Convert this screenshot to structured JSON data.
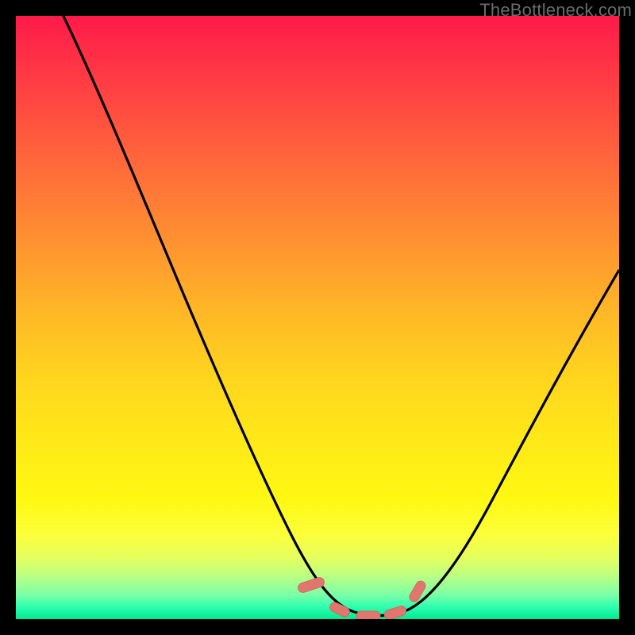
{
  "watermark": "TheBottleneck.com",
  "colors": {
    "background": "#000000",
    "curve_stroke": "#000000",
    "marker_fill": "#e0776e",
    "marker_stroke": "#d8665e",
    "watermark_text": "#6b6b6b"
  },
  "chart_data": {
    "type": "line",
    "title": "",
    "xlabel": "",
    "ylabel": "",
    "xlim": [
      0,
      100
    ],
    "ylim": [
      0,
      100
    ],
    "grid": false,
    "legend": false,
    "background": "rainbow-vertical-gradient",
    "x": [
      0,
      3,
      6,
      9,
      12,
      15,
      18,
      21,
      24,
      27,
      30,
      33,
      36,
      39,
      42,
      45,
      48,
      51,
      54,
      57,
      60,
      63,
      66,
      69,
      72,
      75,
      78,
      81,
      84,
      87,
      90,
      93,
      96,
      100
    ],
    "series": [
      {
        "name": "curve",
        "values": [
          104,
          96,
          89,
          82,
          75,
          69,
          62,
          56,
          50,
          44,
          38,
          33,
          27,
          22,
          17,
          12,
          8,
          5,
          2,
          1,
          0,
          0,
          1,
          4,
          9,
          16,
          24,
          31,
          38,
          44,
          49,
          54,
          59,
          65
        ]
      }
    ],
    "markers": [
      {
        "x": 50,
        "y": 4,
        "shape": "capsule",
        "angle": 75
      },
      {
        "x": 53,
        "y": 1,
        "shape": "rounded-rect",
        "angle": 0
      },
      {
        "x": 59,
        "y": 0,
        "shape": "rounded-rect",
        "angle": 0
      },
      {
        "x": 63,
        "y": 1,
        "shape": "rounded-rect",
        "angle": 0
      },
      {
        "x": 66,
        "y": 4,
        "shape": "capsule",
        "angle": 65
      }
    ],
    "annotations": []
  }
}
